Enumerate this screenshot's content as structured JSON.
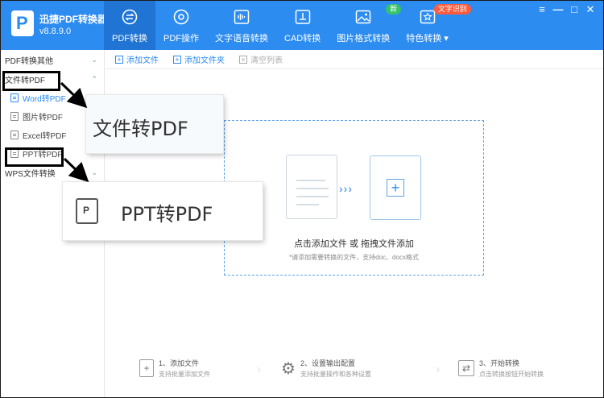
{
  "app": {
    "name": "迅捷PDF转换器",
    "version": "v8.8.9.0",
    "logo_letter": "P"
  },
  "nav": [
    {
      "label": "PDF转换",
      "icon": "exchange-icon",
      "active": true
    },
    {
      "label": "PDF操作",
      "icon": "gear-cycle-icon"
    },
    {
      "label": "文字语音转换",
      "icon": "audio-wave-icon"
    },
    {
      "label": "CAD转换",
      "icon": "cad-icon"
    },
    {
      "label": "图片格式转换",
      "icon": "image-icon",
      "badge": "新"
    },
    {
      "label": "特色转换 ▾",
      "icon": "star-icon",
      "badge": "文字识别"
    }
  ],
  "window_controls": {
    "menu": "≡",
    "minimize": "—",
    "maximize": "□",
    "close": "✕"
  },
  "sidebar": {
    "groups": [
      {
        "label": "PDF转换其他",
        "chevron": "⌄"
      },
      {
        "label": "文件转PDF",
        "chevron": "⌃"
      },
      {
        "label": "WPS文件转换",
        "chevron": "⌄"
      }
    ],
    "items": [
      "Word转PDF",
      "图片转PDF",
      "Excel转PDF",
      "PPT转PDF"
    ]
  },
  "toolbar": {
    "add_file": "添加文件",
    "add_folder": "添加文件夹",
    "clear_list": "清空列表"
  },
  "dropzone": {
    "title": "点击添加文件 或 拖拽文件添加",
    "subtitle": "*请添加需要转换的文件，支持doc、docx格式",
    "arrows": "›››",
    "plus": "+"
  },
  "steps": [
    {
      "title": "1、添加文件",
      "desc": "支持批量添加文件"
    },
    {
      "title": "2、设置输出配置",
      "desc": "支持批量操作和各种设置"
    },
    {
      "title": "3、开始转换",
      "desc": "点击转换按钮开始转换"
    }
  ],
  "callouts": {
    "category": "文件转PDF",
    "item": "PPT转PDF",
    "item_icon_letter": "P"
  },
  "colors": {
    "brand": "#2c8cf0",
    "nav_active": "#1f74d4",
    "badge_new": "#35c26a",
    "badge_hot": "#ff5b3d"
  }
}
